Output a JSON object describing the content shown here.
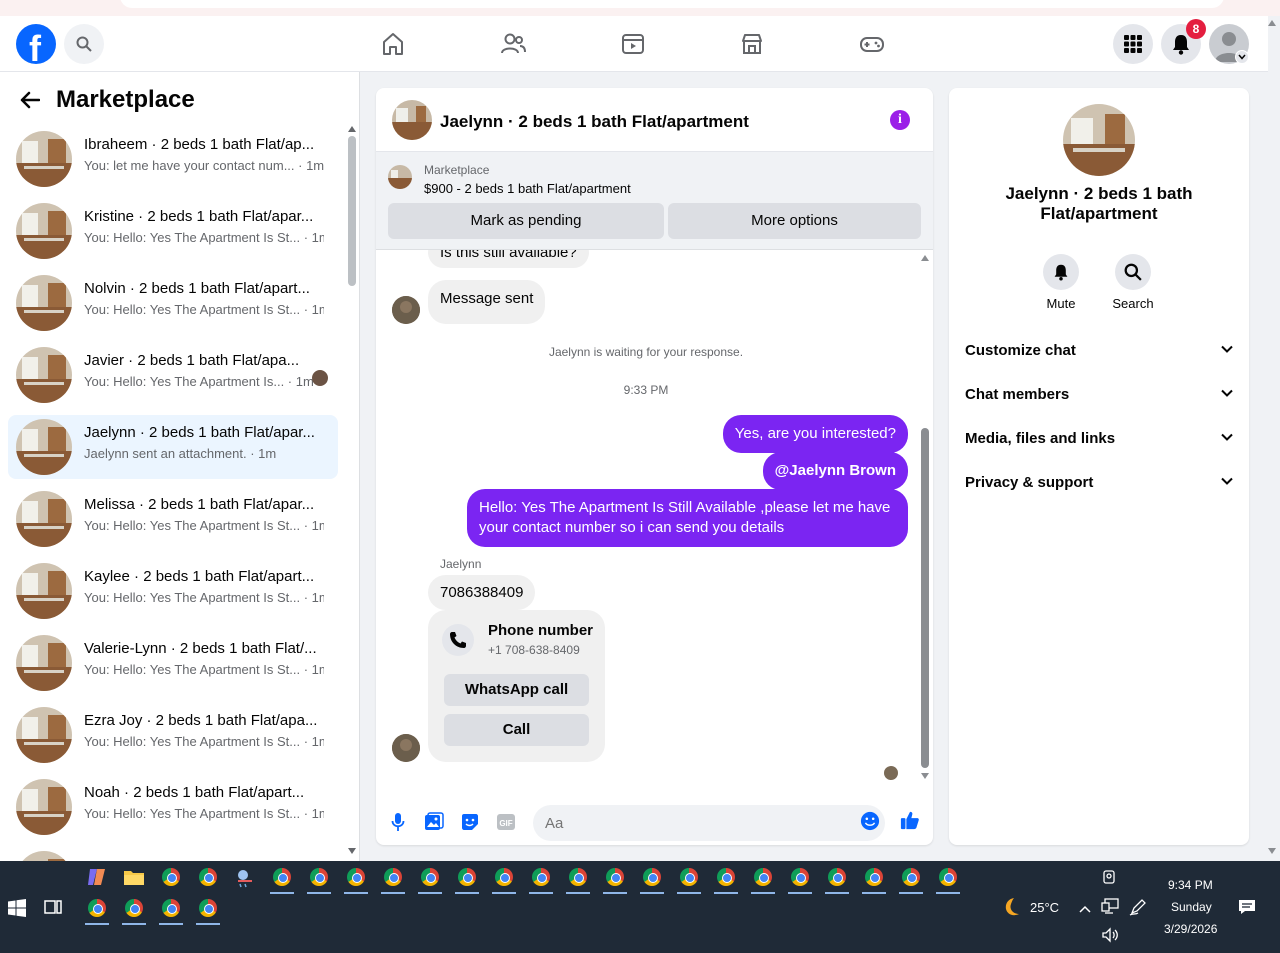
{
  "header": {
    "logo_letter": "f",
    "notif_count": "8"
  },
  "left": {
    "title": "Marketplace",
    "conversations": [
      {
        "title": "Ibraheem · 2 beds 1 bath Flat/ap...",
        "preview": "You: let me have your contact num... · 1m"
      },
      {
        "title": "Kristine · 2 beds 1 bath Flat/apar...",
        "preview": "You: Hello: Yes The Apartment Is St... · 1m"
      },
      {
        "title": "Nolvin · 2 beds 1 bath Flat/apart...",
        "preview": "You: Hello: Yes The Apartment Is St... · 1m"
      },
      {
        "title": "Javier · 2 beds 1 bath Flat/apa...",
        "preview": "You: Hello: Yes The Apartment Is... · 1m"
      },
      {
        "title": "Jaelynn · 2 beds 1 bath Flat/apar...",
        "preview": "Jaelynn sent an attachment. · 1m"
      },
      {
        "title": "Melissa · 2 beds 1 bath Flat/apar...",
        "preview": "You: Hello: Yes The Apartment Is St... · 1m"
      },
      {
        "title": "Kaylee · 2 beds 1 bath Flat/apart...",
        "preview": "You: Hello: Yes The Apartment Is St... · 1m"
      },
      {
        "title": "Valerie-Lynn · 2 beds 1 bath Flat/...",
        "preview": "You: Hello: Yes The Apartment Is St... · 1m"
      },
      {
        "title": "Ezra Joy · 2 beds 1 bath Flat/apa...",
        "preview": "You: Hello: Yes The Apartment Is St... · 1m"
      },
      {
        "title": "Noah · 2 beds 1 bath Flat/apart...",
        "preview": "You: Hello: Yes The Apartment Is St... · 1m"
      }
    ]
  },
  "chat": {
    "title": "Jaelynn · 2 beds 1 bath Flat/apartment",
    "info_glyph": "i",
    "listing_source": "Marketplace",
    "listing_desc": "$900 - 2 beds 1 bath Flat/apartment",
    "mark_pending": "Mark as pending",
    "more_options": "More options",
    "messages": {
      "in_still_available": "Is this still available?",
      "in_message_sent": "Message sent",
      "system_waiting": "Jaelynn is waiting for your response.",
      "timestamp": "9:33 PM",
      "out_interested": "Yes, are you interested?",
      "out_mention": "@Jaelynn Brown",
      "out_details": "Hello: Yes The Apartment Is Still Available ,please let me have your contact number so i can send you details",
      "sender_label": "Jaelynn",
      "in_number": "7086388409",
      "phone_title": "Phone number",
      "phone_value": "+1 708-638-8409",
      "whatsapp_call": "WhatsApp call",
      "call": "Call"
    },
    "composer_placeholder": "Aa"
  },
  "right": {
    "name": "Jaelynn · 2 beds 1 bath Flat/apartment",
    "mute": "Mute",
    "search": "Search",
    "sections": [
      "Customize chat",
      "Chat members",
      "Media, files and links",
      "Privacy & support"
    ]
  },
  "taskbar": {
    "weather": "25°C",
    "time": "9:34 PM",
    "day": "Sunday",
    "date": "3/29/2026"
  },
  "colors": {
    "fb_blue": "#0866ff",
    "outgoing_bubble": "#7b25f2",
    "badge_red": "#e41e3f"
  }
}
